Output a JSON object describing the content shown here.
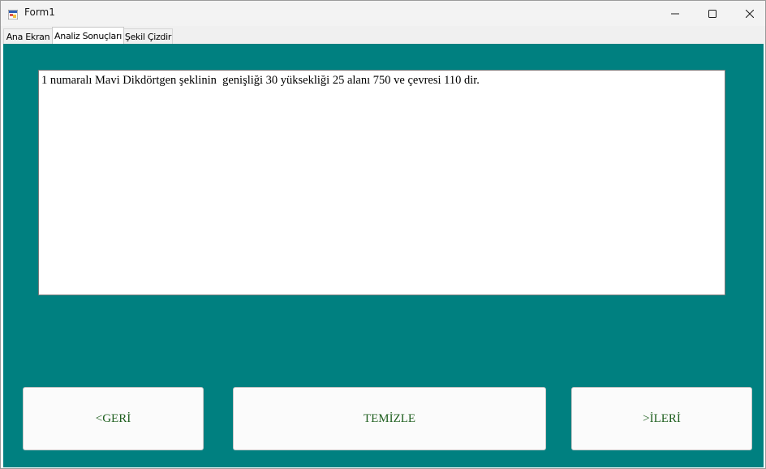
{
  "window": {
    "title": "Form1",
    "controls": {
      "minimize": "minimize-icon",
      "maximize": "maximize-icon",
      "close": "close-icon"
    }
  },
  "tabs": [
    {
      "label": "Ana Ekran",
      "active": false
    },
    {
      "label": "Analiz Sonuçları",
      "active": true
    },
    {
      "label": "Şekil Çizdir",
      "active": false
    }
  ],
  "results": {
    "text": "1 numaralı Mavi Dikdörtgen şeklinin  genişliği 30 yüksekliği 25 alanı 750 ve çevresi 110 dir."
  },
  "buttons": {
    "back": "<GERİ",
    "clear": "TEMİZLE",
    "next": ">İLERİ"
  },
  "colors": {
    "tabpage_bg": "#008080",
    "button_text": "#1f5f1f"
  }
}
